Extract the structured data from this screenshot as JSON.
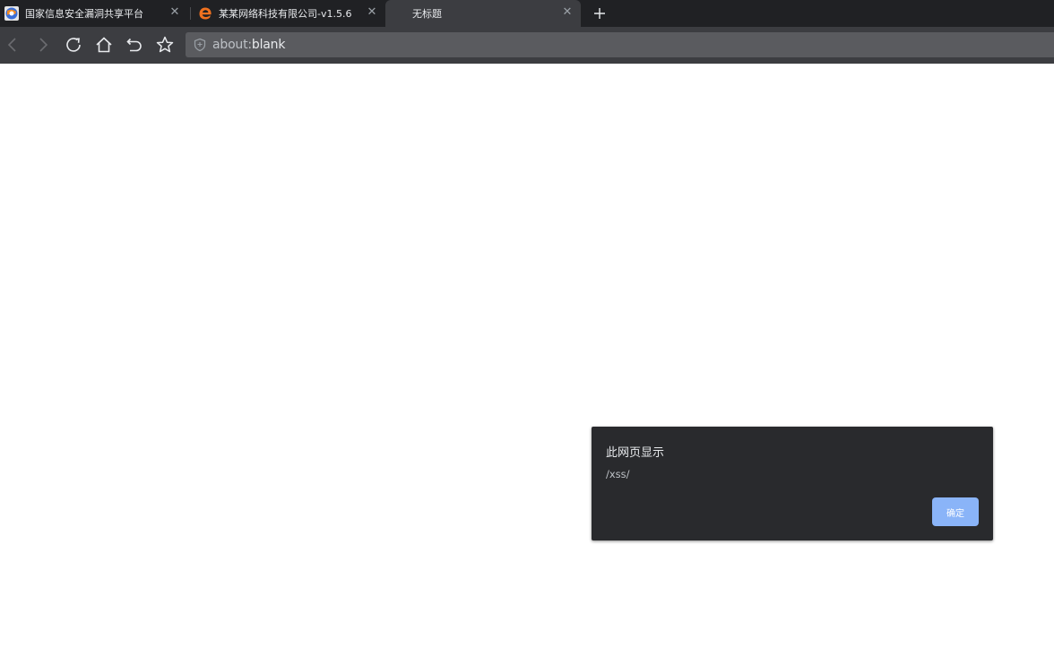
{
  "tabs": [
    {
      "title": "国家信息安全漏洞共享平台",
      "icon": "cnvd-globe-icon",
      "active": false
    },
    {
      "title": "某某网络科技有限公司-v1.5.6",
      "icon": "edge-logo-icon",
      "active": false
    },
    {
      "title": "无标题",
      "icon": "",
      "active": true
    }
  ],
  "tab_close_glyph": "✕",
  "address_bar": {
    "url_scheme": "about:",
    "url_rest": "blank",
    "security_icon": "shield-icon"
  },
  "toolbar_icons": [
    "back-icon",
    "forward-icon",
    "reload-icon",
    "home-icon",
    "undo-close-tab-icon",
    "bookmark-star-icon"
  ],
  "alert_dialog": {
    "title": "此网页显示",
    "message": "/xss/",
    "ok_label": "确定"
  },
  "colors": {
    "tabbar": "#202124",
    "toolbar": "#3c3d41",
    "omnibox": "#5a5b5f",
    "dialog_bg": "#292a2d",
    "ok_button": "#8ab4f8"
  }
}
